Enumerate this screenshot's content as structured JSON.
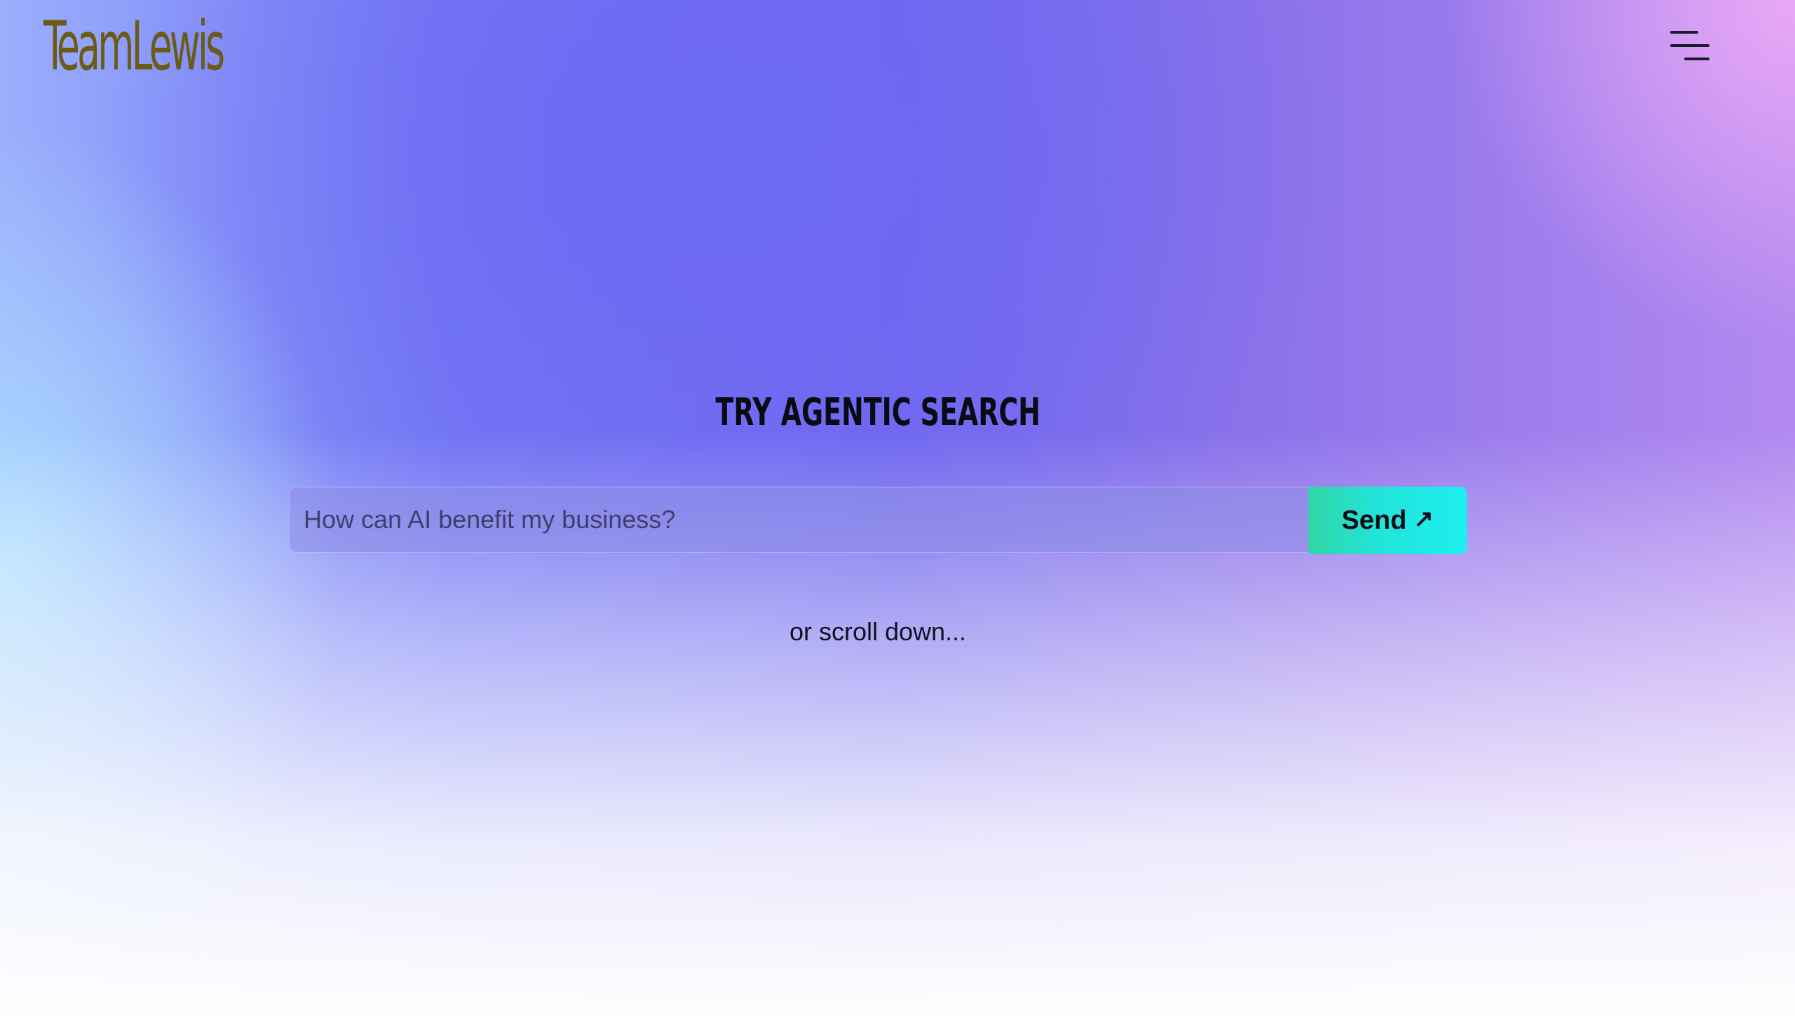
{
  "brand": {
    "logo_text": "TeamLewis",
    "logo_color": "#6c5a17"
  },
  "header": {
    "menu_icon": "hamburger-menu-icon"
  },
  "hero": {
    "heading": "TRY AGENTIC SEARCH",
    "search_placeholder": "How can AI benefit my business?",
    "send_label": "Send",
    "send_icon": "arrow-up-right-icon",
    "scroll_hint": "or scroll down..."
  },
  "colors": {
    "button_gradient_start": "#31d6a6",
    "button_gradient_end": "#1defef",
    "background_primary": "#7268ee"
  }
}
